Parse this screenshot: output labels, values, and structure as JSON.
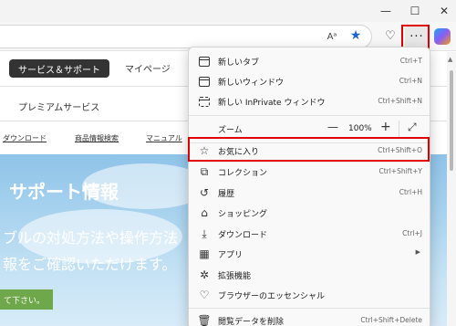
{
  "window": {
    "minimize_glyph": "—",
    "maximize_glyph": "☐",
    "close_glyph": "✕"
  },
  "toolbar": {
    "read_aloud_glyph": "Aᵃ",
    "favorite_glyph": "★",
    "browser_essentials_glyph": "♡",
    "more_glyph": "···"
  },
  "page": {
    "nav": {
      "support": "サービス＆サポート",
      "mypage": "マイページ"
    },
    "premium": "プレミアムサービス",
    "sublinks": [
      "ダウンロード",
      "商品情報検索",
      "マニュアル"
    ],
    "hero": {
      "title": "サポート情報",
      "line1": "ブルの対処方法や操作方法",
      "line2": "報をご確認いただけます。",
      "button": "て下さい。"
    }
  },
  "menu": {
    "items": [
      {
        "label": "新しいタブ",
        "shortcut": "Ctrl+T",
        "icon": "new-tab-icon"
      },
      {
        "label": "新しいウィンドウ",
        "shortcut": "Ctrl+N",
        "icon": "new-window-icon"
      },
      {
        "label": "新しい InPrivate ウィンドウ",
        "shortcut": "Ctrl+Shift+N",
        "icon": "inprivate-icon"
      },
      {
        "label": "ズーム",
        "zoom_minus": "—",
        "zoom_value": "100%",
        "zoom_plus": "+",
        "fullscreen_glyph": "⤢"
      },
      {
        "label": "お気に入り",
        "shortcut": "Ctrl+Shift+O",
        "icon": "favorites-icon"
      },
      {
        "label": "コレクション",
        "shortcut": "Ctrl+Shift+Y",
        "icon": "collections-icon"
      },
      {
        "label": "履歴",
        "shortcut": "Ctrl+H",
        "icon": "history-icon"
      },
      {
        "label": "ショッピング",
        "shortcut": "",
        "icon": "shopping-icon"
      },
      {
        "label": "ダウンロード",
        "shortcut": "Ctrl+J",
        "icon": "download-icon"
      },
      {
        "label": "アプリ",
        "shortcut": "",
        "arrow": "▶",
        "icon": "apps-icon"
      },
      {
        "label": "拡張機能",
        "shortcut": "",
        "icon": "extensions-icon"
      },
      {
        "label": "ブラウザーのエッセンシャル",
        "shortcut": "",
        "icon": "essentials-icon"
      },
      {
        "label": "閲覧データを削除",
        "shortcut": "Ctrl+Shift+Delete",
        "icon": "delete-data-icon"
      }
    ]
  }
}
